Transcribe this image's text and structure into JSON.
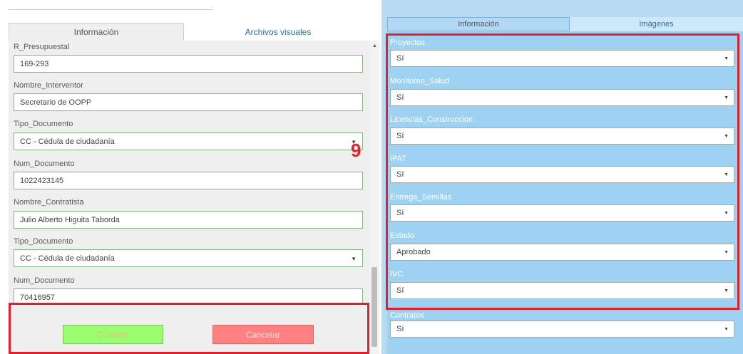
{
  "left": {
    "tabs": [
      "Información",
      "Archivos visuales"
    ],
    "fields": [
      {
        "label": "R_Presupuestal",
        "value": "169-293",
        "kind": "text"
      },
      {
        "label": "Nombre_Interventor",
        "value": "Secretario de OOPP",
        "kind": "text"
      },
      {
        "label": "Tipo_Documento",
        "value": "CC - Cédula de ciudadanía",
        "kind": "select"
      },
      {
        "label": "Num_Documento",
        "value": "1022423145",
        "kind": "text"
      },
      {
        "label": "Nombre_Contratista",
        "value": "Julio Alberto Higuita Taborda",
        "kind": "text"
      },
      {
        "label": "Tipo_Documento",
        "value": "CC - Cédula de ciudadanía",
        "kind": "select"
      },
      {
        "label": "Num_Documento",
        "value": "70416957",
        "kind": "text"
      }
    ],
    "buttons": {
      "save": "Guardar",
      "cancel": "Cancelar"
    }
  },
  "annotation": {
    "number": "9",
    "color": "#e0202c"
  },
  "right": {
    "tabs": [
      "Información",
      "Imágenes"
    ],
    "fields": [
      {
        "label": "Proyectos",
        "value": "Sí"
      },
      {
        "label": "Monitoreo_Salud",
        "value": "Sí"
      },
      {
        "label": "Licencias_Construccion",
        "value": "Sí"
      },
      {
        "label": "IPAT",
        "value": "Sí"
      },
      {
        "label": "Entrega_Semillas",
        "value": "Sí"
      },
      {
        "label": "Estado",
        "value": "Aprobado"
      },
      {
        "label": "IVC",
        "value": "Sí"
      },
      {
        "label": "Contratos",
        "value": "Sí"
      }
    ]
  },
  "colors": {
    "save_bg": "#9aff70",
    "cancel_bg": "#ff8080",
    "right_panel_bg": "#9ed2f2",
    "highlight": "#e0202c"
  }
}
